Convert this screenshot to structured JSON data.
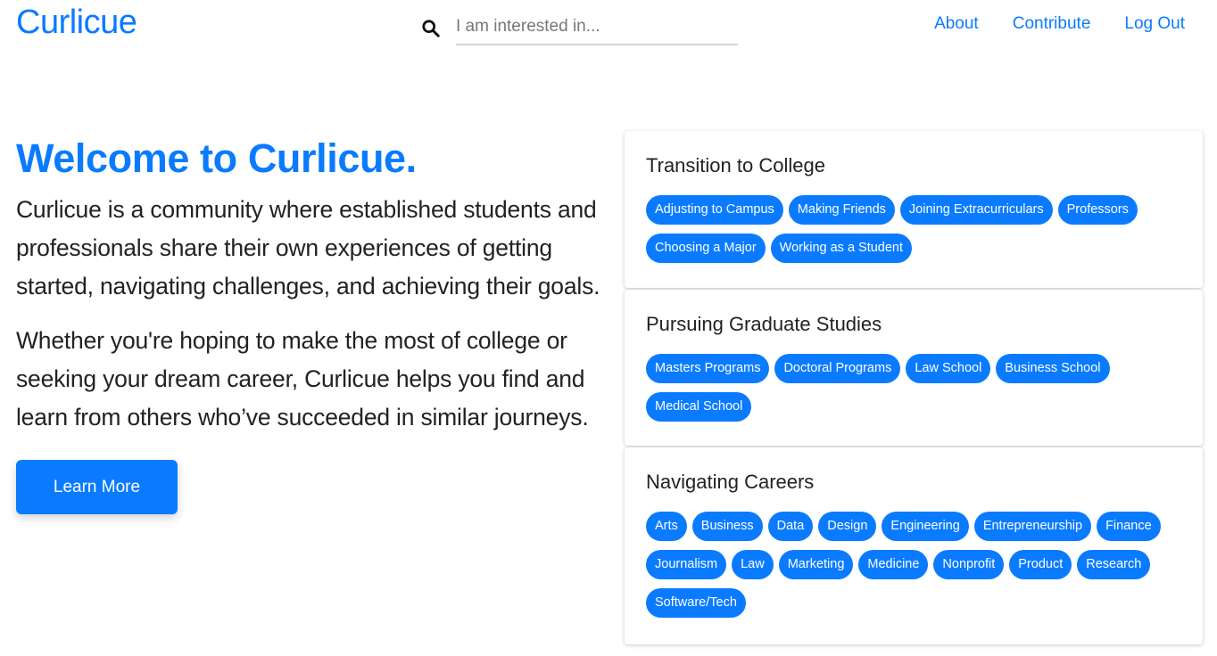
{
  "brand": "Curlicue",
  "search": {
    "placeholder": "I am interested in...",
    "icon": "search-icon"
  },
  "nav": {
    "about": "About",
    "contribute": "Contribute",
    "logout": "Log Out"
  },
  "hero": {
    "title": "Welcome to Curlicue.",
    "paragraph1": "Curlicue is a community where established students and professionals share their own experiences of getting started, navigating challenges, and achieving their goals.",
    "paragraph2": "Whether you're hoping to make the most of college or seeking your dream career, Curlicue helps you find and learn from others who’ve succeeded in similar journeys.",
    "button": "Learn More"
  },
  "categories": [
    {
      "title": "Transition to College",
      "tags": [
        "Adjusting to Campus",
        "Making Friends",
        "Joining Extracurriculars",
        "Professors",
        "Choosing a Major",
        "Working as a Student"
      ]
    },
    {
      "title": "Pursuing Graduate Studies",
      "tags": [
        "Masters Programs",
        "Doctoral Programs",
        "Law School",
        "Business School",
        "Medical School"
      ]
    },
    {
      "title": "Navigating Careers",
      "tags": [
        "Arts",
        "Business",
        "Data",
        "Design",
        "Engineering",
        "Entrepreneurship",
        "Finance",
        "Journalism",
        "Law",
        "Marketing",
        "Medicine",
        "Nonprofit",
        "Product",
        "Research",
        "Software/Tech"
      ]
    }
  ],
  "colors": {
    "accent": "#0a7bff",
    "text": "#222222",
    "underline": "#d7d7d7"
  }
}
